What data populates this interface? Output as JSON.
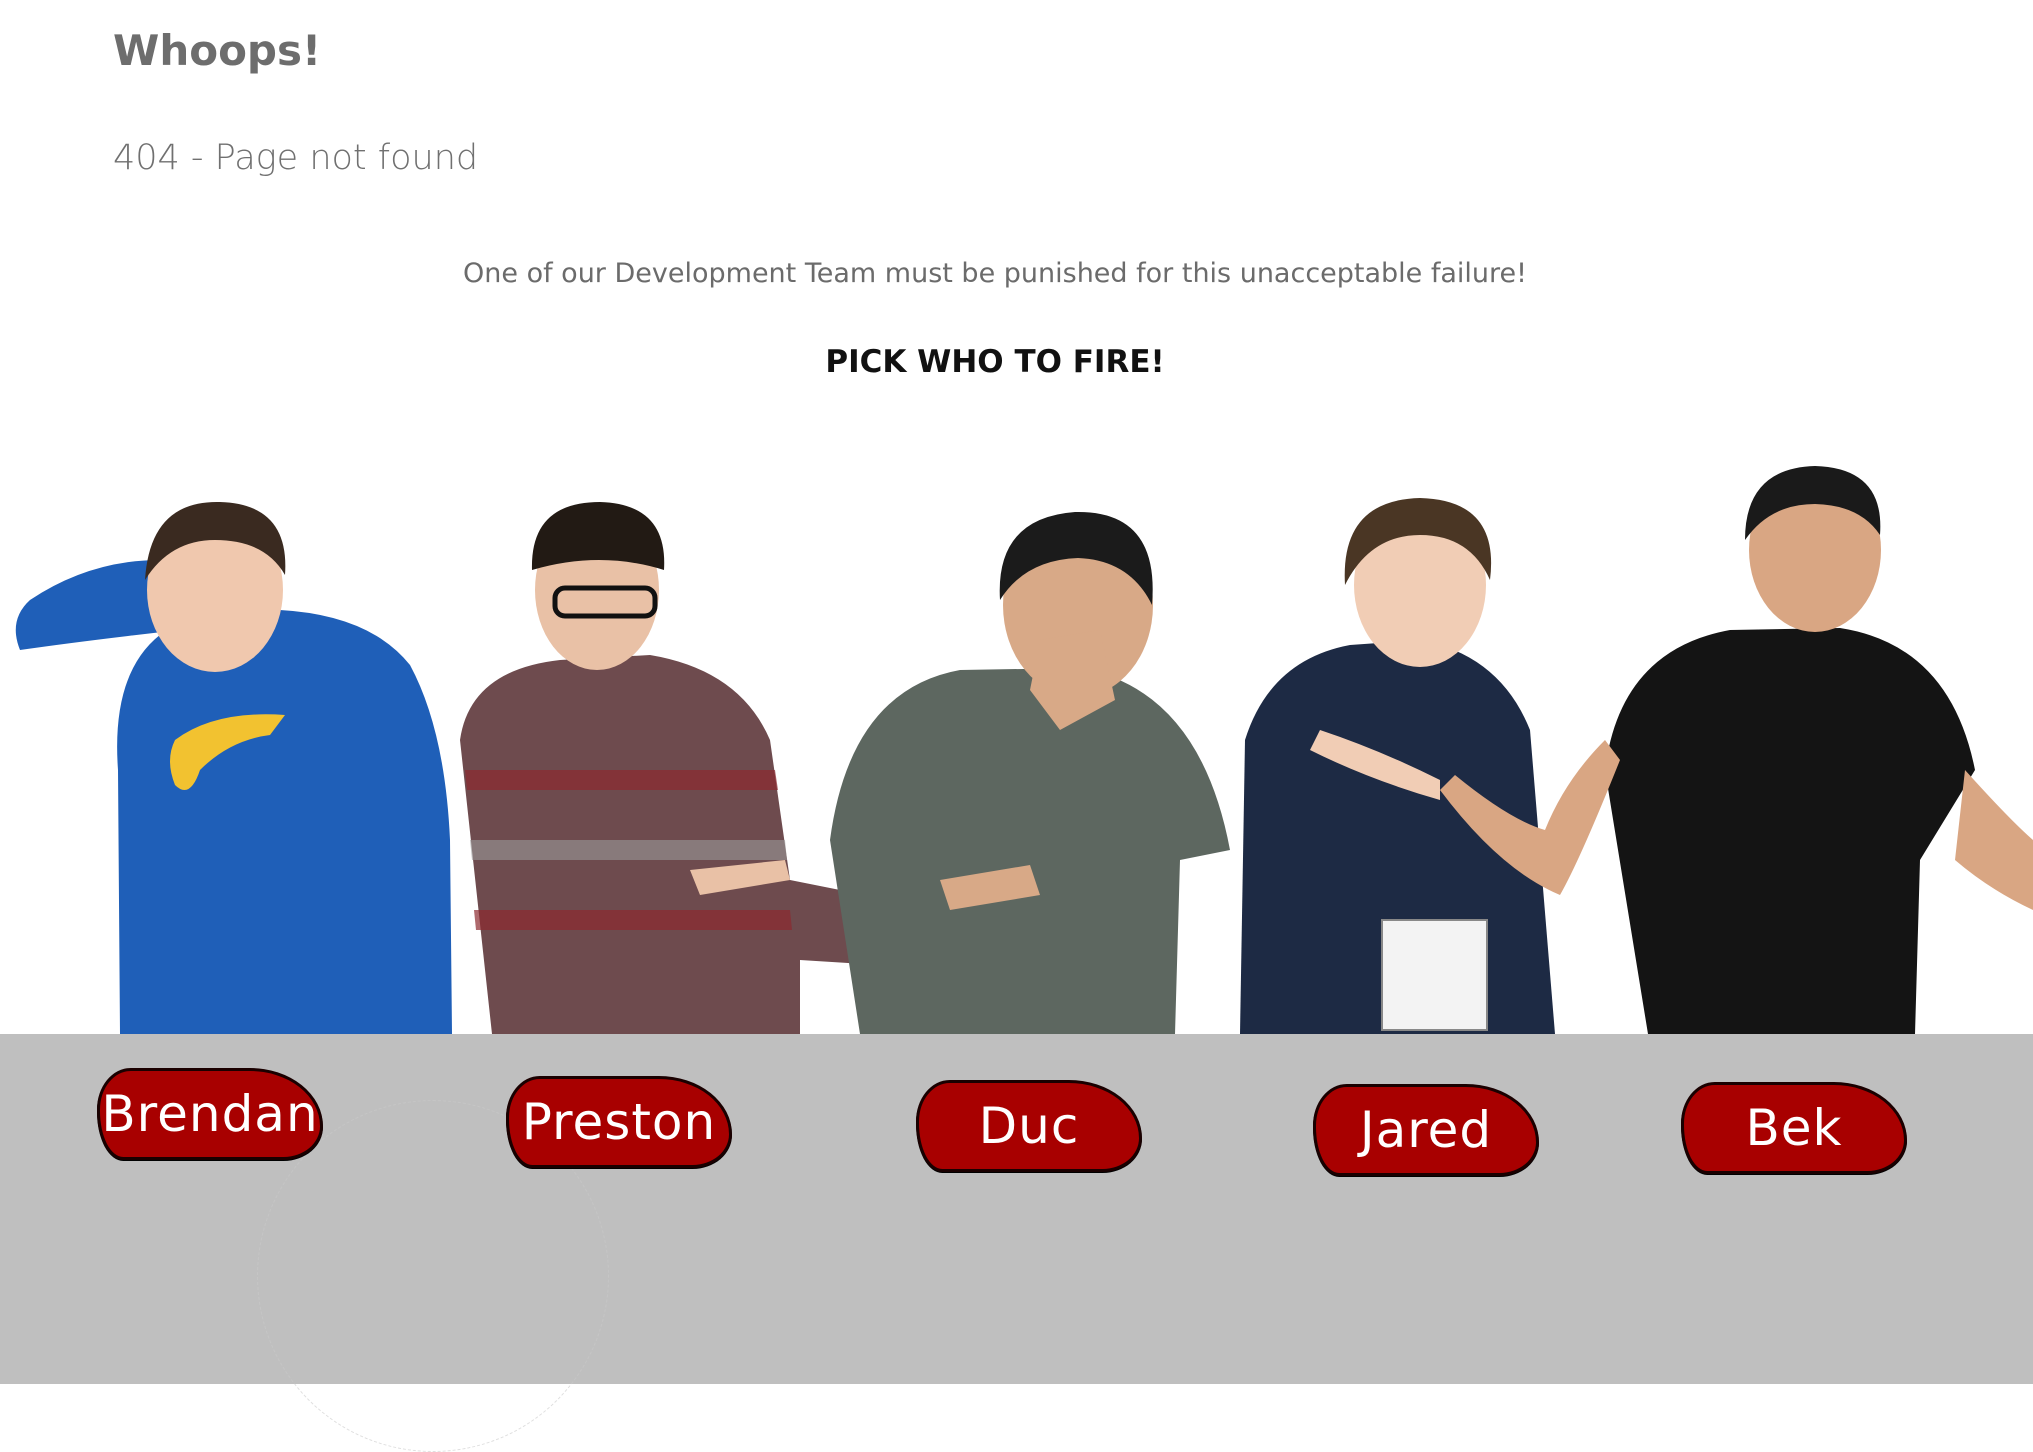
{
  "page": {
    "heading": "Whoops!",
    "subheading": "404 - Page not found",
    "message": "One of our Development Team must be punished for this unacceptable failure!",
    "call_to_action": "PICK WHO TO FIRE!"
  },
  "team": [
    {
      "name": "Brendan",
      "shirt_color": "#1f5fb8",
      "skin": "#f0c8ae",
      "hair": "#3a2a20"
    },
    {
      "name": "Preston",
      "shirt_color": "#6e4b4e",
      "skin": "#e9c1a6",
      "hair": "#221a14"
    },
    {
      "name": "Duc",
      "shirt_color": "#5d6760",
      "skin": "#d8a987",
      "hair": "#1b1b1b"
    },
    {
      "name": "Jared",
      "shirt_color": "#1d2a44",
      "skin": "#f1cdb5",
      "hair": "#4a3624"
    },
    {
      "name": "Bek",
      "shirt_color": "#141414",
      "skin": "#d9a683",
      "hair": "#1a1a1a"
    }
  ],
  "colors": {
    "button_fill": "#a80000",
    "floor": "#bfbfbf",
    "background": "#ffffff"
  }
}
